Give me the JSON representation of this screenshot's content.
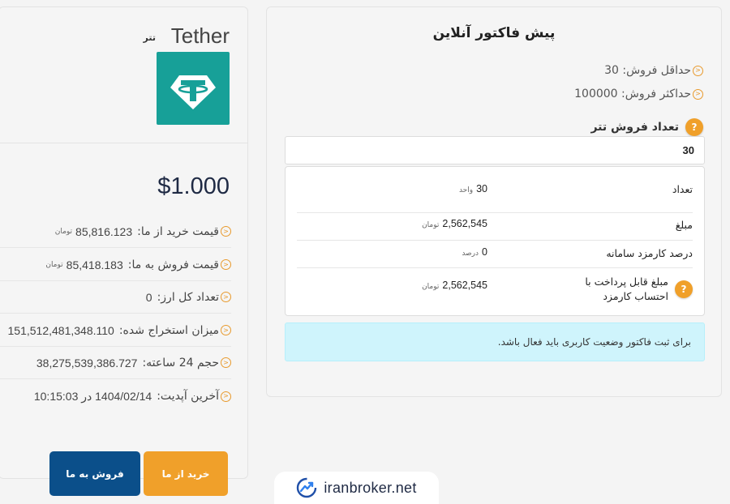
{
  "coin": {
    "name": "Tether",
    "subtitle": "تتر",
    "logo_color": "#17a098",
    "price_usd": "$1.000",
    "info": [
      {
        "label": "قیمت خرید از ما:",
        "value": "85,816.123",
        "unit": "تومان"
      },
      {
        "label": "قیمت فروش به ما:",
        "value": "85,418.183",
        "unit": "تومان"
      },
      {
        "label": "تعداد کل ارز:",
        "value": "0",
        "unit": ""
      },
      {
        "label": "میزان استخراج شده:",
        "value": "151,512,481,348.110",
        "unit": ""
      },
      {
        "label": "حجم 24 ساعته:",
        "value": "38,275,539,386.727",
        "unit": ""
      },
      {
        "label": "آخرین آپدیت:",
        "value": "1404/02/14 در 10:15:03",
        "unit": ""
      }
    ],
    "buy_label": "خرید از ما",
    "sell_label": "فروش به ما",
    "buy_color": "#f0a02a",
    "sell_color": "#0b4f8a"
  },
  "invoice": {
    "title": "پیش فاکتور آنلاین",
    "min_sell": "حداقل فروش: 30",
    "max_sell": "حداکثر فروش: 100000",
    "qty_label": "تعداد فروش تتر",
    "qty_value": "30",
    "rows": [
      {
        "label": "تعداد",
        "value": "30",
        "unit": "واحد"
      },
      {
        "label": "مبلغ",
        "value": "2,562,545",
        "unit": "تومان"
      },
      {
        "label": "درصد کارمزد سامانه",
        "value": "0",
        "unit": "درصد"
      },
      {
        "label": "مبلغ قابل پرداخت با احتساب کارمزد",
        "value": "2,562,545",
        "unit": "تومان"
      }
    ],
    "alert": "برای ثبت فاکتور وضعیت کاربری باید فعال باشد."
  },
  "footer": {
    "brand": "iranbroker.net"
  }
}
